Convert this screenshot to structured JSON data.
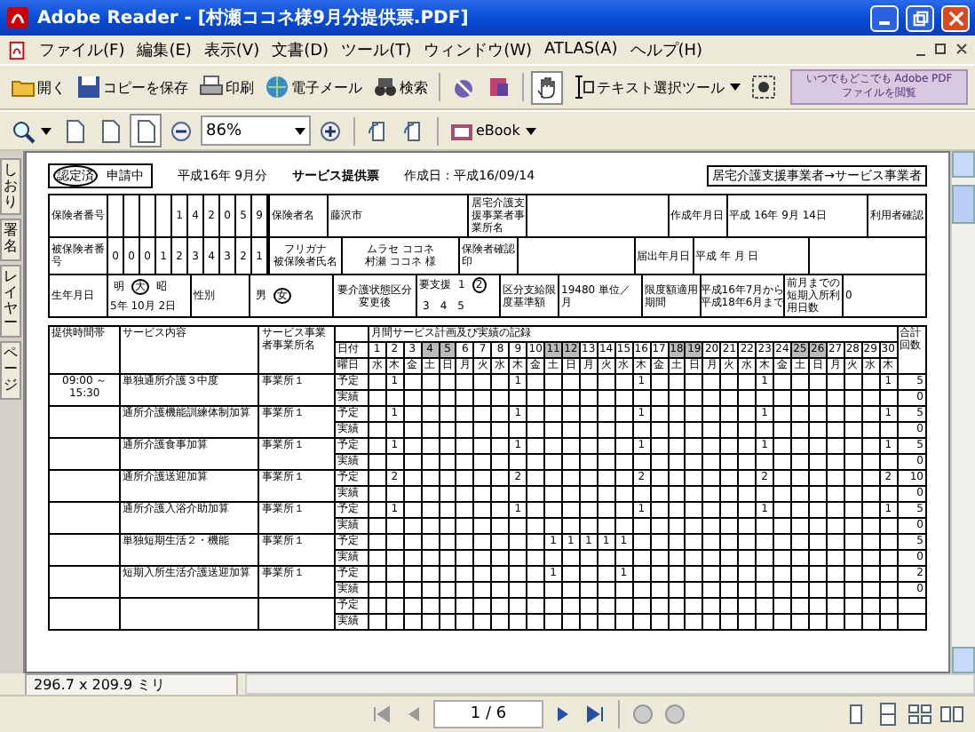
{
  "window": {
    "title": "Adobe Reader - [村瀬ココネ様9月分提供票.PDF]"
  },
  "menu": [
    "ファイル(F)",
    "編集(E)",
    "表示(V)",
    "文書(D)",
    "ツール(T)",
    "ウィンドウ(W)",
    "ATLAS(A)",
    "ヘルプ(H)"
  ],
  "toolbar": [
    {
      "kind": "open",
      "label": "開く",
      "selected": false
    },
    {
      "kind": "save",
      "label": "コピーを保存",
      "selected": false
    },
    {
      "kind": "print",
      "label": "印刷",
      "selected": false
    },
    {
      "kind": "email",
      "label": "電子メール",
      "selected": false
    },
    {
      "kind": "search",
      "label": "検索",
      "selected": false
    },
    {
      "kind": "sign",
      "selected": false
    },
    {
      "kind": "stamp",
      "selected": false
    },
    {
      "kind": "hand",
      "selected": true
    },
    {
      "kind": "textselect",
      "label": "テキスト選択ツール",
      "selected": false
    },
    {
      "kind": "snapshot",
      "selected": false
    }
  ],
  "ad": [
    "いつでもどこでも Adobe PDF",
    "ファイルを閲覧"
  ],
  "toolbar2": [
    {
      "kind": "zoomtool"
    },
    {
      "kind": "actualsize",
      "selected": false
    },
    {
      "kind": "fitpage",
      "selected": false
    },
    {
      "kind": "fitwidth",
      "selected": true
    },
    {
      "kind": "zoomout"
    },
    {
      "kind": "zoomfield",
      "value": "86%"
    },
    {
      "kind": "zoomin"
    },
    {
      "kind": "rotateleft"
    },
    {
      "kind": "rotateright"
    },
    {
      "kind": "ebook",
      "label": "eBook"
    }
  ],
  "side_tabs": [
    "しおり",
    "署名",
    "レイヤー",
    "ページ"
  ],
  "document": {
    "stamp": [
      {
        "label": "認定済",
        "selected": true
      },
      {
        "label": "申請中",
        "selected": false
      }
    ],
    "period": "平成16年 9月分",
    "title": "サービス提供票",
    "created": "作成日：平成16/09/14",
    "direction": "居宅介護支援事業者→サービス事業者",
    "info_rows": [
      [
        {
          "kind": "label",
          "text": "保険者番号"
        },
        {
          "kind": "digits",
          "digits": [
            "1",
            "4",
            "2",
            "0",
            "5",
            "9"
          ]
        },
        {
          "kind": "label",
          "text": "保険者名"
        },
        {
          "kind": "value",
          "text": "藤沢市"
        },
        {
          "kind": "label",
          "text": "居宅介護支援事業者事業所名"
        },
        {
          "kind": "blank"
        },
        {
          "kind": "label",
          "text": "作成年月日"
        },
        {
          "kind": "value",
          "text": "平成 16年 9月 14日"
        },
        {
          "kind": "label",
          "text": "利用者確認"
        }
      ],
      [
        {
          "kind": "label",
          "text": "被保険者番号"
        },
        {
          "kind": "digits",
          "digits": [
            "0",
            "0",
            "0",
            "1",
            "2",
            "3",
            "4",
            "3",
            "2",
            "1"
          ]
        },
        {
          "kind": "label",
          "lines": [
            "フリガナ",
            "被保険者氏名"
          ]
        },
        {
          "kind": "value",
          "lines": [
            "ムラセ ココネ",
            "村瀬 ココネ 様"
          ]
        },
        {
          "kind": "label",
          "text": "保険者確認印"
        },
        {
          "kind": "blank"
        },
        {
          "kind": "label",
          "text": "届出年月日"
        },
        {
          "kind": "value",
          "text": "平成 年 月 日"
        },
        {
          "kind": "blank"
        }
      ],
      [
        {
          "kind": "label",
          "text": "生年月日"
        },
        {
          "kind": "options",
          "options": [
            {
              "label": "明",
              "selected": false
            },
            {
              "label": "大",
              "selected": true
            },
            {
              "label": "昭",
              "selected": false
            }
          ],
          "text": "5年 10月 2日"
        },
        {
          "kind": "label",
          "text": "性別"
        },
        {
          "kind": "options",
          "options": [
            {
              "label": "男",
              "selected": false
            },
            {
              "label": "女",
              "selected": true
            }
          ]
        },
        {
          "kind": "label",
          "lines": [
            "要介護状態区分",
            "変更後"
          ]
        },
        {
          "kind": "options",
          "text": "要支援",
          "options": [
            {
              "label": "1",
              "selected": false
            },
            {
              "label": "2",
              "selected": true
            },
            {
              "label": "3",
              "selected": false
            },
            {
              "label": "4",
              "selected": false
            },
            {
              "label": "5",
              "selected": false
            }
          ]
        },
        {
          "kind": "label",
          "text": "区分支給限度基準額"
        },
        {
          "kind": "value",
          "text": "19480 単位／月"
        },
        {
          "kind": "label",
          "text": "限度額適用期間"
        },
        {
          "kind": "value",
          "lines": [
            "平成16年7月から",
            "平成18年6月まで"
          ]
        },
        {
          "kind": "label",
          "text": "前月までの短期入所利用日数"
        },
        {
          "kind": "value",
          "text": "0"
        }
      ]
    ],
    "table": {
      "time_header": "提供時間帯",
      "content_header": "サービス内容",
      "provider_header": "サービス事業者事業所名",
      "record_header": "月間サービス計画及び実績の記録",
      "date_label": "日付",
      "weekday_label": "曜日",
      "total_header": "合計回数",
      "days": [
        {
          "day": "1",
          "weekday": "水",
          "weekend": false
        },
        {
          "day": "2",
          "weekday": "木",
          "weekend": false
        },
        {
          "day": "3",
          "weekday": "金",
          "weekend": false
        },
        {
          "day": "4",
          "weekday": "土",
          "weekend": true
        },
        {
          "day": "5",
          "weekday": "日",
          "weekend": true
        },
        {
          "day": "6",
          "weekday": "月",
          "weekend": false
        },
        {
          "day": "7",
          "weekday": "火",
          "weekend": false
        },
        {
          "day": "8",
          "weekday": "水",
          "weekend": false
        },
        {
          "day": "9",
          "weekday": "木",
          "weekend": false
        },
        {
          "day": "10",
          "weekday": "金",
          "weekend": false
        },
        {
          "day": "11",
          "weekday": "土",
          "weekend": true
        },
        {
          "day": "12",
          "weekday": "日",
          "weekend": true
        },
        {
          "day": "13",
          "weekday": "月",
          "weekend": false
        },
        {
          "day": "14",
          "weekday": "火",
          "weekend": false
        },
        {
          "day": "15",
          "weekday": "水",
          "weekend": false
        },
        {
          "day": "16",
          "weekday": "木",
          "weekend": false
        },
        {
          "day": "17",
          "weekday": "金",
          "weekend": false
        },
        {
          "day": "18",
          "weekday": "土",
          "weekend": true
        },
        {
          "day": "19",
          "weekday": "日",
          "weekend": true
        },
        {
          "day": "20",
          "weekday": "月",
          "weekend": false
        },
        {
          "day": "21",
          "weekday": "火",
          "weekend": false
        },
        {
          "day": "22",
          "weekday": "水",
          "weekend": false
        },
        {
          "day": "23",
          "weekday": "木",
          "weekend": false
        },
        {
          "day": "24",
          "weekday": "金",
          "weekend": false
        },
        {
          "day": "25",
          "weekday": "土",
          "weekend": true
        },
        {
          "day": "26",
          "weekday": "日",
          "weekend": true
        },
        {
          "day": "27",
          "weekday": "月",
          "weekend": false
        },
        {
          "day": "28",
          "weekday": "火",
          "weekend": false
        },
        {
          "day": "29",
          "weekday": "水",
          "weekend": false
        },
        {
          "day": "30",
          "weekday": "木",
          "weekend": false
        }
      ],
      "rows": [
        {
          "time": "09:00 ～ 15:30",
          "content": "単独通所介護３中度",
          "provider": "事業所１",
          "plan_label": "予定",
          "actual_label": "実績",
          "plan": [
            {
              "kind": "blank"
            },
            {
              "kind": "count",
              "value": "1"
            },
            {
              "kind": "blank"
            },
            {
              "kind": "blank"
            },
            {
              "kind": "blank"
            },
            {
              "kind": "blank"
            },
            {
              "kind": "blank"
            },
            {
              "kind": "blank"
            },
            {
              "kind": "count",
              "value": "1"
            },
            {
              "kind": "blank"
            },
            {
              "kind": "blank"
            },
            {
              "kind": "blank"
            },
            {
              "kind": "blank"
            },
            {
              "kind": "blank"
            },
            {
              "kind": "blank"
            },
            {
              "kind": "count",
              "value": "1"
            },
            {
              "kind": "blank"
            },
            {
              "kind": "blank"
            },
            {
              "kind": "blank"
            },
            {
              "kind": "blank"
            },
            {
              "kind": "blank"
            },
            {
              "kind": "blank"
            },
            {
              "kind": "count",
              "value": "1"
            },
            {
              "kind": "blank"
            },
            {
              "kind": "blank"
            },
            {
              "kind": "blank"
            },
            {
              "kind": "blank"
            },
            {
              "kind": "blank"
            },
            {
              "kind": "blank"
            },
            {
              "kind": "count",
              "value": "1"
            }
          ],
          "plan_total": "5",
          "actual_total": "0"
        },
        {
          "content": "通所介護機能訓練体制加算",
          "provider": "事業所１",
          "plan_label": "予定",
          "actual_label": "実績",
          "plan": [
            {
              "kind": "blank"
            },
            {
              "kind": "count",
              "value": "1"
            },
            {
              "kind": "blank"
            },
            {
              "kind": "blank"
            },
            {
              "kind": "blank"
            },
            {
              "kind": "blank"
            },
            {
              "kind": "blank"
            },
            {
              "kind": "blank"
            },
            {
              "kind": "count",
              "value": "1"
            },
            {
              "kind": "blank"
            },
            {
              "kind": "blank"
            },
            {
              "kind": "blank"
            },
            {
              "kind": "blank"
            },
            {
              "kind": "blank"
            },
            {
              "kind": "blank"
            },
            {
              "kind": "count",
              "value": "1"
            },
            {
              "kind": "blank"
            },
            {
              "kind": "blank"
            },
            {
              "kind": "blank"
            },
            {
              "kind": "blank"
            },
            {
              "kind": "blank"
            },
            {
              "kind": "blank"
            },
            {
              "kind": "count",
              "value": "1"
            },
            {
              "kind": "blank"
            },
            {
              "kind": "blank"
            },
            {
              "kind": "blank"
            },
            {
              "kind": "blank"
            },
            {
              "kind": "blank"
            },
            {
              "kind": "blank"
            },
            {
              "kind": "count",
              "value": "1"
            }
          ],
          "plan_total": "5",
          "actual_total": "0"
        },
        {
          "content": "通所介護食事加算",
          "provider": "事業所１",
          "plan_label": "予定",
          "actual_label": "実績",
          "plan": [
            {
              "kind": "blank"
            },
            {
              "kind": "count",
              "value": "1"
            },
            {
              "kind": "blank"
            },
            {
              "kind": "blank"
            },
            {
              "kind": "blank"
            },
            {
              "kind": "blank"
            },
            {
              "kind": "blank"
            },
            {
              "kind": "blank"
            },
            {
              "kind": "count",
              "value": "1"
            },
            {
              "kind": "blank"
            },
            {
              "kind": "blank"
            },
            {
              "kind": "blank"
            },
            {
              "kind": "blank"
            },
            {
              "kind": "blank"
            },
            {
              "kind": "blank"
            },
            {
              "kind": "count",
              "value": "1"
            },
            {
              "kind": "blank"
            },
            {
              "kind": "blank"
            },
            {
              "kind": "blank"
            },
            {
              "kind": "blank"
            },
            {
              "kind": "blank"
            },
            {
              "kind": "blank"
            },
            {
              "kind": "count",
              "value": "1"
            },
            {
              "kind": "blank"
            },
            {
              "kind": "blank"
            },
            {
              "kind": "blank"
            },
            {
              "kind": "blank"
            },
            {
              "kind": "blank"
            },
            {
              "kind": "blank"
            },
            {
              "kind": "count",
              "value": "1"
            }
          ],
          "plan_total": "5",
          "actual_total": "0"
        },
        {
          "content": "通所介護送迎加算",
          "provider": "事業所１",
          "plan_label": "予定",
          "actual_label": "実績",
          "plan": [
            {
              "kind": "blank"
            },
            {
              "kind": "count",
              "value": "2"
            },
            {
              "kind": "blank"
            },
            {
              "kind": "blank"
            },
            {
              "kind": "blank"
            },
            {
              "kind": "blank"
            },
            {
              "kind": "blank"
            },
            {
              "kind": "blank"
            },
            {
              "kind": "count",
              "value": "2"
            },
            {
              "kind": "blank"
            },
            {
              "kind": "blank"
            },
            {
              "kind": "blank"
            },
            {
              "kind": "blank"
            },
            {
              "kind": "blank"
            },
            {
              "kind": "blank"
            },
            {
              "kind": "count",
              "value": "2"
            },
            {
              "kind": "blank"
            },
            {
              "kind": "blank"
            },
            {
              "kind": "blank"
            },
            {
              "kind": "blank"
            },
            {
              "kind": "blank"
            },
            {
              "kind": "blank"
            },
            {
              "kind": "count",
              "value": "2"
            },
            {
              "kind": "blank"
            },
            {
              "kind": "blank"
            },
            {
              "kind": "blank"
            },
            {
              "kind": "blank"
            },
            {
              "kind": "blank"
            },
            {
              "kind": "blank"
            },
            {
              "kind": "count",
              "value": "2"
            }
          ],
          "plan_total": "10",
          "actual_total": "0"
        },
        {
          "content": "通所介護入浴介助加算",
          "provider": "事業所１",
          "plan_label": "予定",
          "actual_label": "実績",
          "plan": [
            {
              "kind": "blank"
            },
            {
              "kind": "count",
              "value": "1"
            },
            {
              "kind": "blank"
            },
            {
              "kind": "blank"
            },
            {
              "kind": "blank"
            },
            {
              "kind": "blank"
            },
            {
              "kind": "blank"
            },
            {
              "kind": "blank"
            },
            {
              "kind": "count",
              "value": "1"
            },
            {
              "kind": "blank"
            },
            {
              "kind": "blank"
            },
            {
              "kind": "blank"
            },
            {
              "kind": "blank"
            },
            {
              "kind": "blank"
            },
            {
              "kind": "blank"
            },
            {
              "kind": "count",
              "value": "1"
            },
            {
              "kind": "blank"
            },
            {
              "kind": "blank"
            },
            {
              "kind": "blank"
            },
            {
              "kind": "blank"
            },
            {
              "kind": "blank"
            },
            {
              "kind": "blank"
            },
            {
              "kind": "count",
              "value": "1"
            },
            {
              "kind": "blank"
            },
            {
              "kind": "blank"
            },
            {
              "kind": "blank"
            },
            {
              "kind": "blank"
            },
            {
              "kind": "blank"
            },
            {
              "kind": "blank"
            },
            {
              "kind": "count",
              "value": "1"
            }
          ],
          "plan_total": "5",
          "actual_total": "0"
        },
        {
          "content": "単独短期生活２・機能",
          "provider": "事業所１",
          "plan_label": "予定",
          "actual_label": "実績",
          "plan": [
            {
              "kind": "blank"
            },
            {
              "kind": "blank"
            },
            {
              "kind": "blank"
            },
            {
              "kind": "blank"
            },
            {
              "kind": "blank"
            },
            {
              "kind": "blank"
            },
            {
              "kind": "blank"
            },
            {
              "kind": "blank"
            },
            {
              "kind": "blank"
            },
            {
              "kind": "blank"
            },
            {
              "kind": "count",
              "value": "1"
            },
            {
              "kind": "count",
              "value": "1"
            },
            {
              "kind": "count",
              "value": "1"
            },
            {
              "kind": "count",
              "value": "1"
            },
            {
              "kind": "count",
              "value": "1"
            },
            {
              "kind": "blank"
            },
            {
              "kind": "blank"
            },
            {
              "kind": "blank"
            },
            {
              "kind": "blank"
            },
            {
              "kind": "blank"
            },
            {
              "kind": "blank"
            },
            {
              "kind": "blank"
            },
            {
              "kind": "blank"
            },
            {
              "kind": "blank"
            },
            {
              "kind": "blank"
            },
            {
              "kind": "blank"
            },
            {
              "kind": "blank"
            },
            {
              "kind": "blank"
            },
            {
              "kind": "blank"
            },
            {
              "kind": "blank"
            }
          ],
          "plan_total": "5",
          "actual_total": "0"
        },
        {
          "content": "短期入所生活介護送迎加算",
          "provider": "事業所１",
          "plan_label": "予定",
          "actual_label": "実績",
          "plan": [
            {
              "kind": "blank"
            },
            {
              "kind": "blank"
            },
            {
              "kind": "blank"
            },
            {
              "kind": "blank"
            },
            {
              "kind": "blank"
            },
            {
              "kind": "blank"
            },
            {
              "kind": "blank"
            },
            {
              "kind": "blank"
            },
            {
              "kind": "blank"
            },
            {
              "kind": "blank"
            },
            {
              "kind": "count",
              "value": "1"
            },
            {
              "kind": "blank"
            },
            {
              "kind": "blank"
            },
            {
              "kind": "blank"
            },
            {
              "kind": "count",
              "value": "1"
            },
            {
              "kind": "blank"
            },
            {
              "kind": "blank"
            },
            {
              "kind": "blank"
            },
            {
              "kind": "blank"
            },
            {
              "kind": "blank"
            },
            {
              "kind": "blank"
            },
            {
              "kind": "blank"
            },
            {
              "kind": "blank"
            },
            {
              "kind": "blank"
            },
            {
              "kind": "blank"
            },
            {
              "kind": "blank"
            },
            {
              "kind": "blank"
            },
            {
              "kind": "blank"
            },
            {
              "kind": "blank"
            },
            {
              "kind": "blank"
            }
          ],
          "plan_total": "2",
          "actual_total": "0"
        },
        {
          "plan_label": "予定",
          "actual_label": "実績"
        }
      ]
    }
  },
  "status": {
    "page_size": "296.7 x 209.9 ミリ",
    "page": "1 / 6"
  }
}
